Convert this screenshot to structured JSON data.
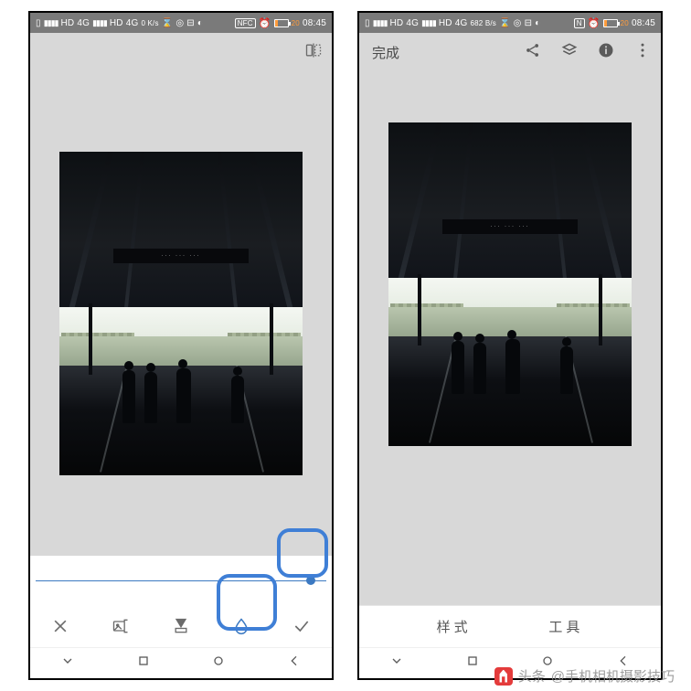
{
  "status": {
    "sim1_label": "HD 4G",
    "sim2_label": "HD 4G",
    "speeds": [
      "0\nK/s",
      "682\nB/s"
    ],
    "nfc": "NFC",
    "battery_pct": 20,
    "clock": "08:45"
  },
  "left": {
    "slider_value": 100,
    "toolbar": {
      "cancel": "×",
      "apply": "✓"
    }
  },
  "right": {
    "done_label": "完成",
    "tabs": {
      "styles": "样式",
      "tools": "工具"
    }
  },
  "photo": {
    "sign_text": "··· ··· ···"
  },
  "highlight": {
    "color": "#3f7fd6"
  },
  "watermark": {
    "prefix": "头条",
    "text": "@手机相机摄影技巧"
  }
}
